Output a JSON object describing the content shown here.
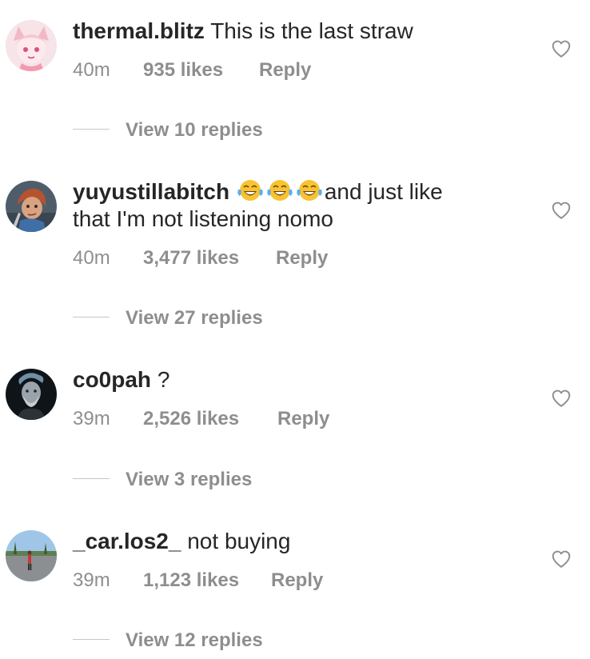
{
  "comments": [
    {
      "username": "thermal.blitz",
      "text": "This is the last straw",
      "time": "40m",
      "likes": "935 likes",
      "reply_label": "Reply",
      "view_replies": "View 10 replies",
      "avatar_icon": "anime-character-avatar"
    },
    {
      "username": "yuyustillabitch",
      "emoji": [
        "face-with-tears-of-joy",
        "face-with-tears-of-joy",
        "face-with-tears-of-joy"
      ],
      "text_line1": "and just like",
      "text_line2": "that I'm not listening nomo",
      "time": "40m",
      "likes": "3,477 likes",
      "reply_label": "Reply",
      "view_replies": "View 27 replies",
      "avatar_icon": "doll-character-avatar"
    },
    {
      "username": "co0pah",
      "text": "?",
      "time": "39m",
      "likes": "2,526 likes",
      "reply_label": "Reply",
      "view_replies": "View 3 replies",
      "avatar_icon": "bearded-man-avatar"
    },
    {
      "username": "_car.los2_",
      "text": "not buying",
      "time": "39m",
      "likes": "1,123 likes",
      "reply_label": "Reply",
      "view_replies": "View 12 replies",
      "avatar_icon": "outdoor-photo-avatar"
    }
  ],
  "colors": {
    "primary_text": "#262626",
    "secondary_text": "#8e8e8e",
    "divider_line": "#c7c7c7",
    "heart_outline": "#8e8e8e"
  }
}
